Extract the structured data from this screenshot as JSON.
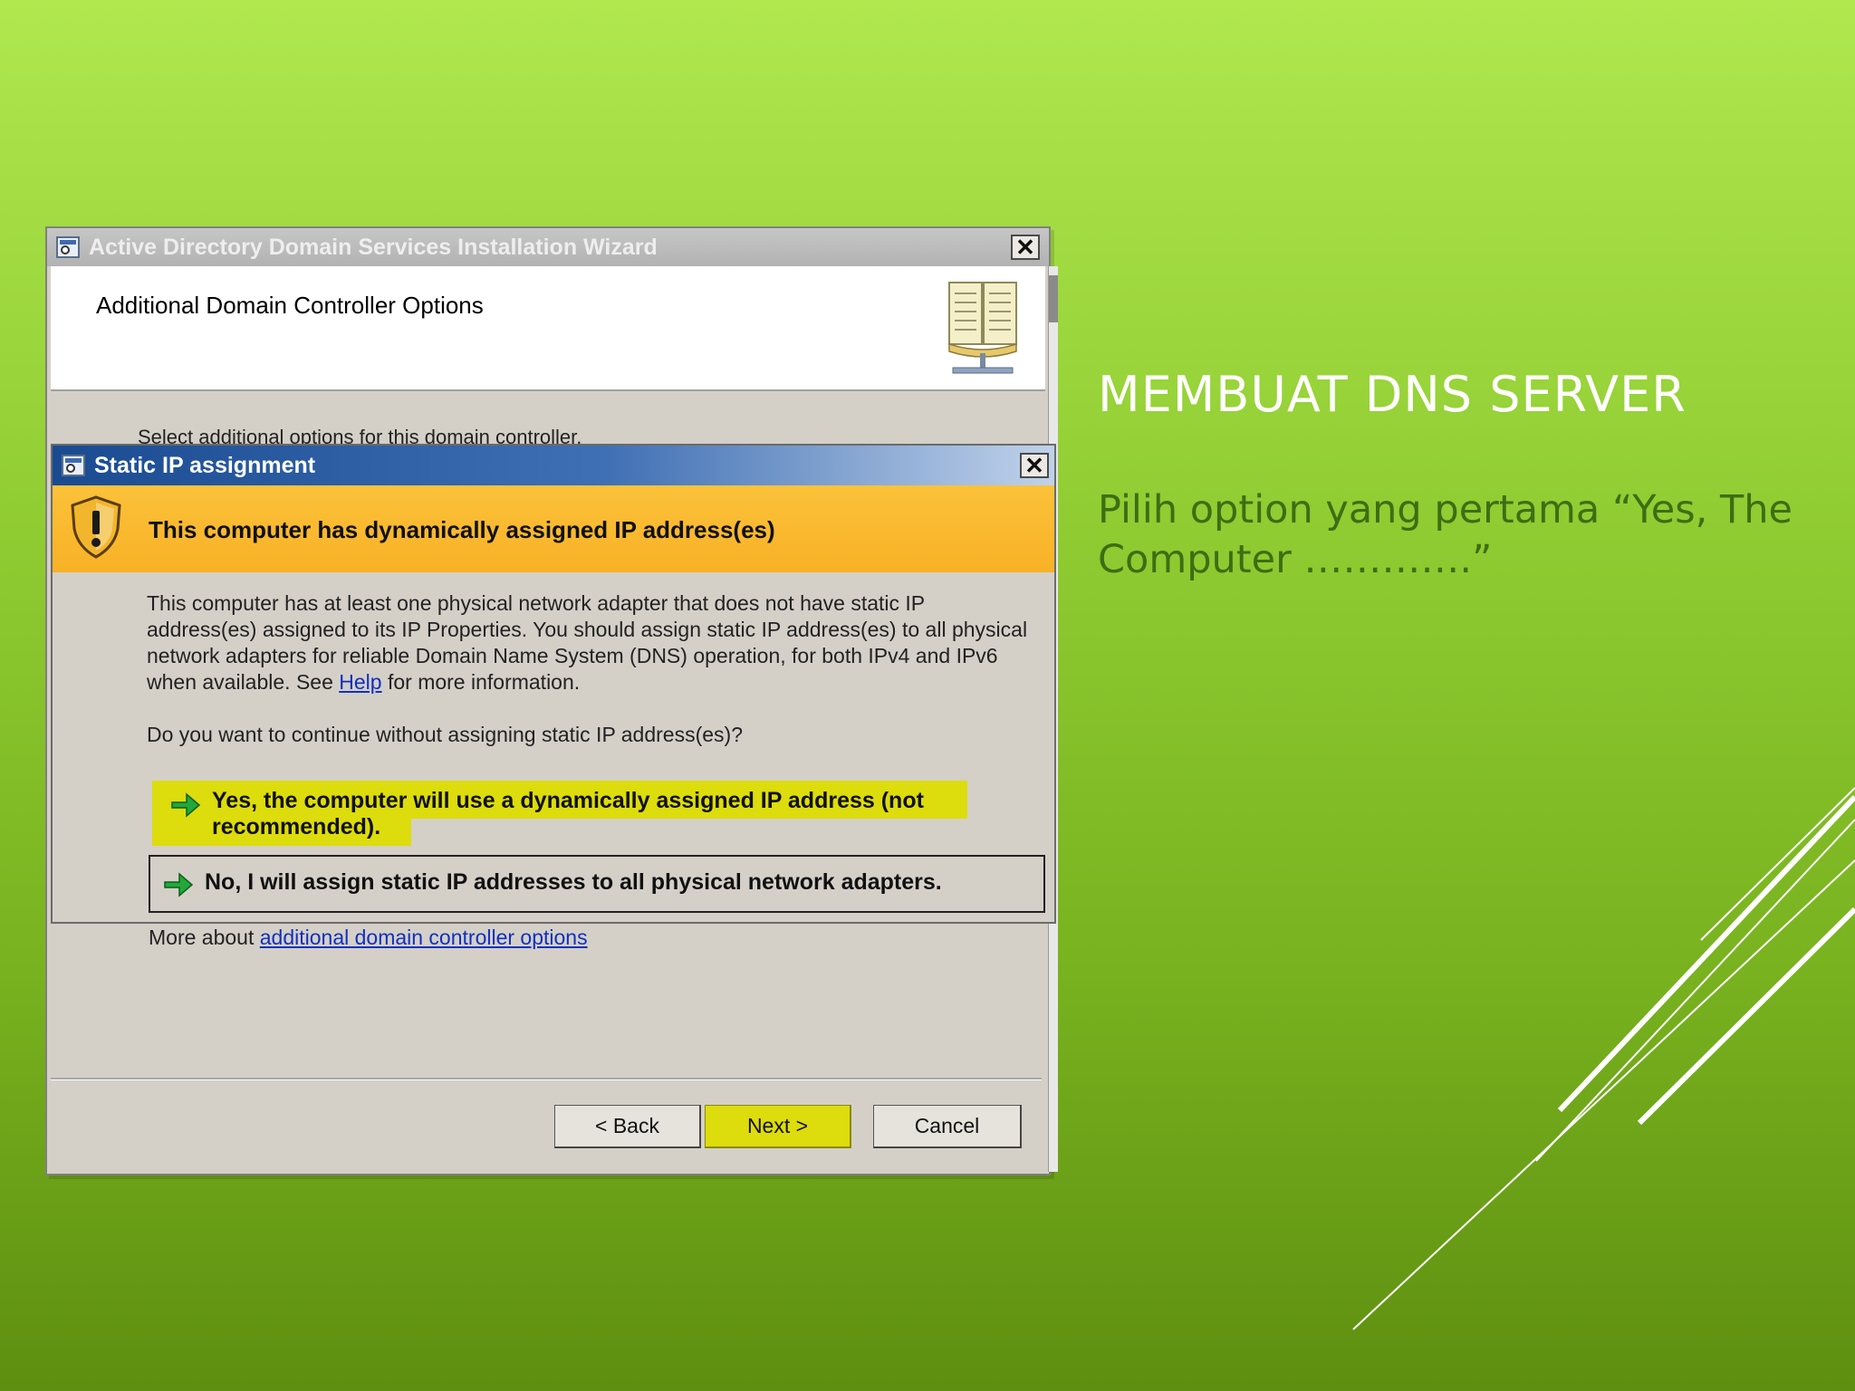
{
  "slide": {
    "title": "MEMBUAT DNS SERVER",
    "body": "Pilih option yang pertama “Yes, The Computer ………….”"
  },
  "wizard": {
    "window_title": "Active Directory Domain Services Installation Wizard",
    "heading": "Additional Domain Controller Options",
    "subtitle": "Select additional options for this domain controller.",
    "more_about_prefix": "More about ",
    "more_about_link": "additional domain controller options",
    "buttons": {
      "back": "< Back",
      "next": "Next >",
      "cancel": "Cancel"
    }
  },
  "dialog": {
    "title": "Static IP assignment",
    "warning": "This computer has dynamically assigned IP address(es)",
    "description_before_link": "This computer has at least one physical network adapter that does not have static IP address(es) assigned to its IP Properties. You should assign static IP address(es) to all physical network adapters for reliable Domain Name System (DNS) operation, for both IPv4 and IPv6 when available. See ",
    "description_link": "Help",
    "description_after_link": " for more information.",
    "question": "Do you want to continue without assigning static IP address(es)?",
    "option_yes": "Yes, the computer will use a dynamically assigned IP address (not recommended).",
    "option_no": "No, I will assign static IP addresses to all physical network adapters."
  },
  "icons": {
    "app": "app-icon",
    "close": "close-icon",
    "book": "book-icon",
    "shield": "warning-shield-icon",
    "arrow": "green-arrow-icon"
  },
  "colors": {
    "highlight": "#dddc0c",
    "warning_band": "#f8b126",
    "dialog_title": "#1a4b91",
    "link": "#1030c0",
    "slide_body_text": "#3d6e12"
  }
}
